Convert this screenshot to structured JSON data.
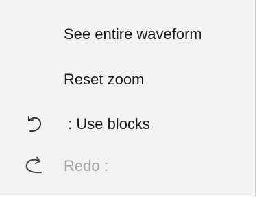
{
  "context_menu": {
    "items": [
      {
        "label": "See entire waveform",
        "icon": null,
        "enabled": true
      },
      {
        "label": "Reset zoom",
        "icon": null,
        "enabled": true
      },
      {
        "label": " : Use blocks",
        "icon": "undo-icon",
        "enabled": true
      },
      {
        "label": "Redo :",
        "icon": "redo-icon",
        "enabled": false
      }
    ]
  },
  "colors": {
    "background": "#f2f2f2",
    "text": "#1a1a1a",
    "disabled_text": "#a6a6a6",
    "icon": "#333333",
    "disabled_icon": "#8a8a8a"
  }
}
